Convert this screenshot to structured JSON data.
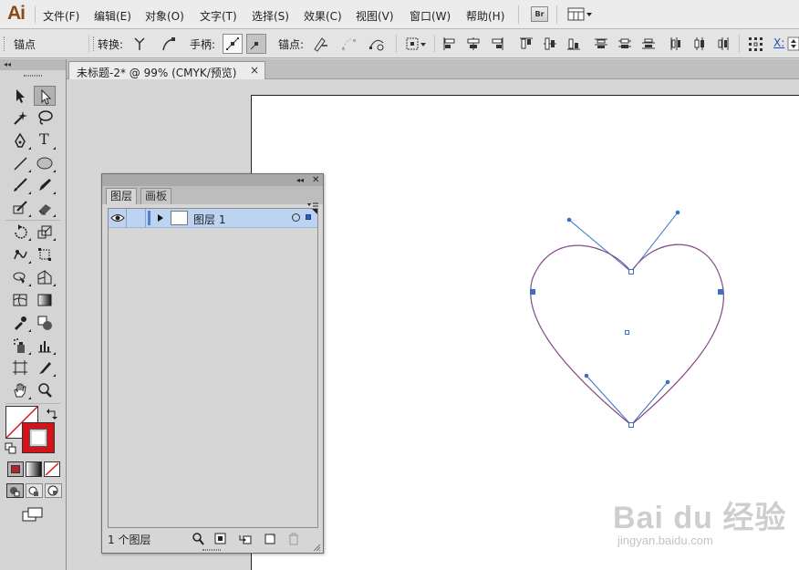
{
  "app": {
    "logo": "Ai",
    "br_button": "Br"
  },
  "menu": {
    "items": [
      "文件(F)",
      "编辑(E)",
      "对象(O)",
      "文字(T)",
      "选择(S)",
      "效果(C)",
      "视图(V)",
      "窗口(W)",
      "帮助(H)"
    ]
  },
  "controlbar": {
    "selection_label": "锚点",
    "convert_label": "转换:",
    "handles_label": "手柄:",
    "anchors_label": "锚点:",
    "partial_label": "X:"
  },
  "document": {
    "tab_title": "未标题-2* @ 99% (CMYK/预览)",
    "close_glyph": "×"
  },
  "tools": {
    "type_glyph": "T"
  },
  "layers_panel": {
    "tabs": [
      "图层",
      "画板"
    ],
    "layer_name": "图层 1",
    "count_text": "1 个图层",
    "collapse_glyph": "◂◂",
    "close_glyph": "✕"
  },
  "artwork": {
    "stroke_color": "#b0326a",
    "path_color": "#3a6fc9",
    "shape": "heart"
  },
  "colors": {
    "fill": "none",
    "stroke": "#d4141c"
  },
  "watermark": {
    "text": "Bai du 经验",
    "url": "jingyan.baidu.com"
  }
}
